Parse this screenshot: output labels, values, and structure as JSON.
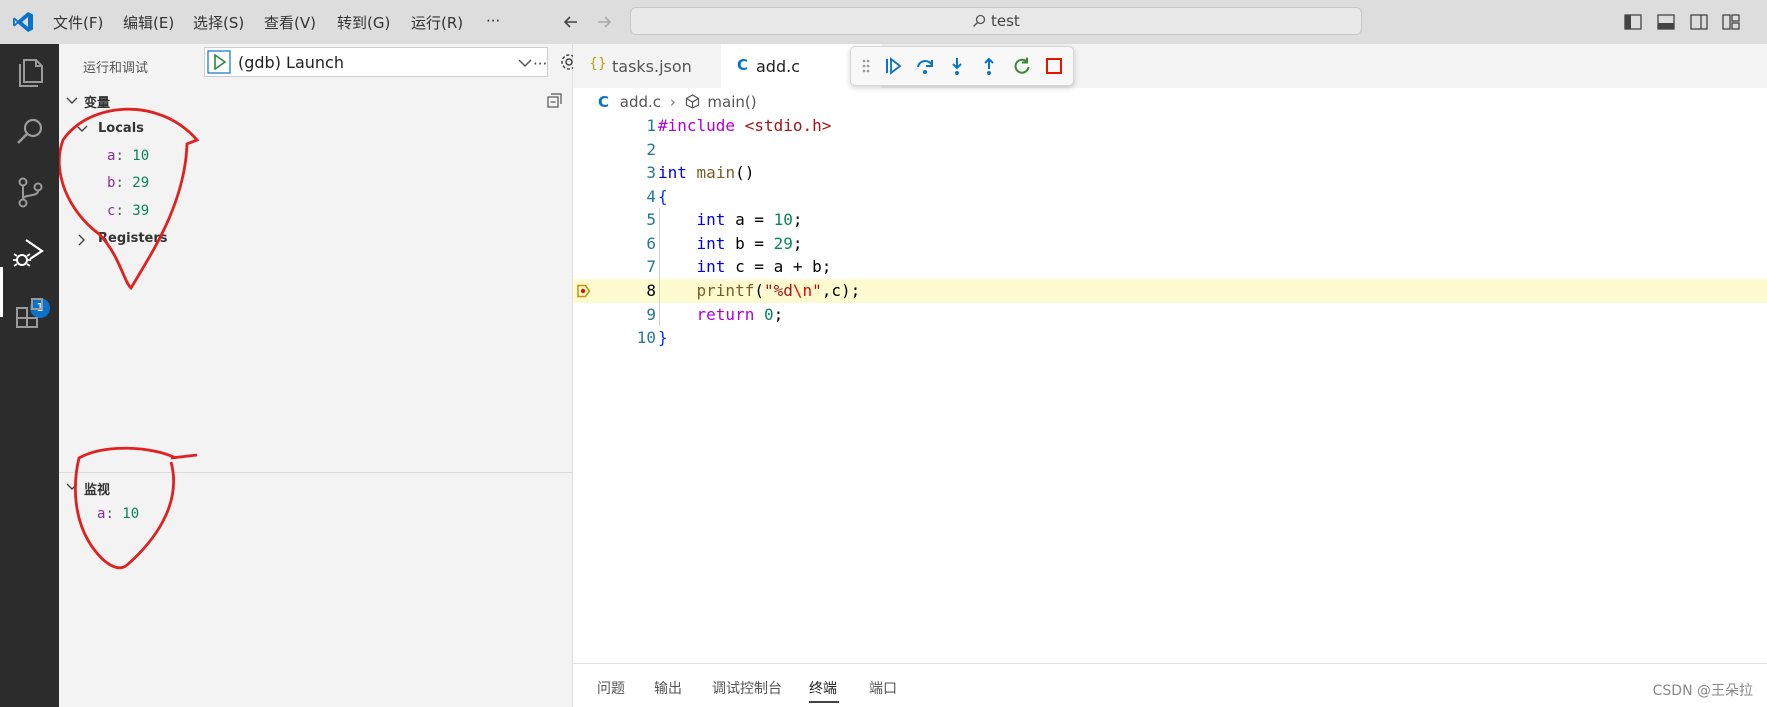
{
  "menu": [
    "文件(F)",
    "编辑(E)",
    "选择(S)",
    "查看(V)",
    "转到(G)",
    "运行(R)",
    "···"
  ],
  "search": {
    "text": "test"
  },
  "activity": {
    "badge": "1"
  },
  "sidebar": {
    "title": "运行和调试",
    "config_select": "(gdb) Launch",
    "more": "···",
    "variables_header": "变量",
    "locals_header": "Locals",
    "locals": [
      {
        "name": "a",
        "value": "10"
      },
      {
        "name": "b",
        "value": "29"
      },
      {
        "name": "c",
        "value": "39"
      }
    ],
    "registers_header": "Registers",
    "watch_header": "监视",
    "watch": [
      {
        "name": "a",
        "value": "10"
      }
    ]
  },
  "tabs": [
    {
      "icon": "{}",
      "label": "tasks.json"
    },
    {
      "icon": "C",
      "label": "add.c"
    }
  ],
  "breadcrumb": {
    "file": "add.c",
    "symbol": "main()"
  },
  "editor": {
    "current_line": 8,
    "lines": [
      {
        "n": "1"
      },
      {
        "n": "2"
      },
      {
        "n": "3"
      },
      {
        "n": "4"
      },
      {
        "n": "5"
      },
      {
        "n": "6"
      },
      {
        "n": "7"
      },
      {
        "n": "8"
      },
      {
        "n": "9"
      },
      {
        "n": "10"
      }
    ]
  },
  "panel_tabs": [
    "问题",
    "输出",
    "调试控制台",
    "终端",
    "端口"
  ],
  "active_panel_tab": "终端",
  "watermark": "CSDN @王朵拉",
  "colors": {
    "keyword": "#0000ff",
    "control": "#af00db",
    "string": "#a31515",
    "number": "#098658",
    "function": "#795e26",
    "highlight": "#fffbd1",
    "annotation": "#e0211f"
  }
}
